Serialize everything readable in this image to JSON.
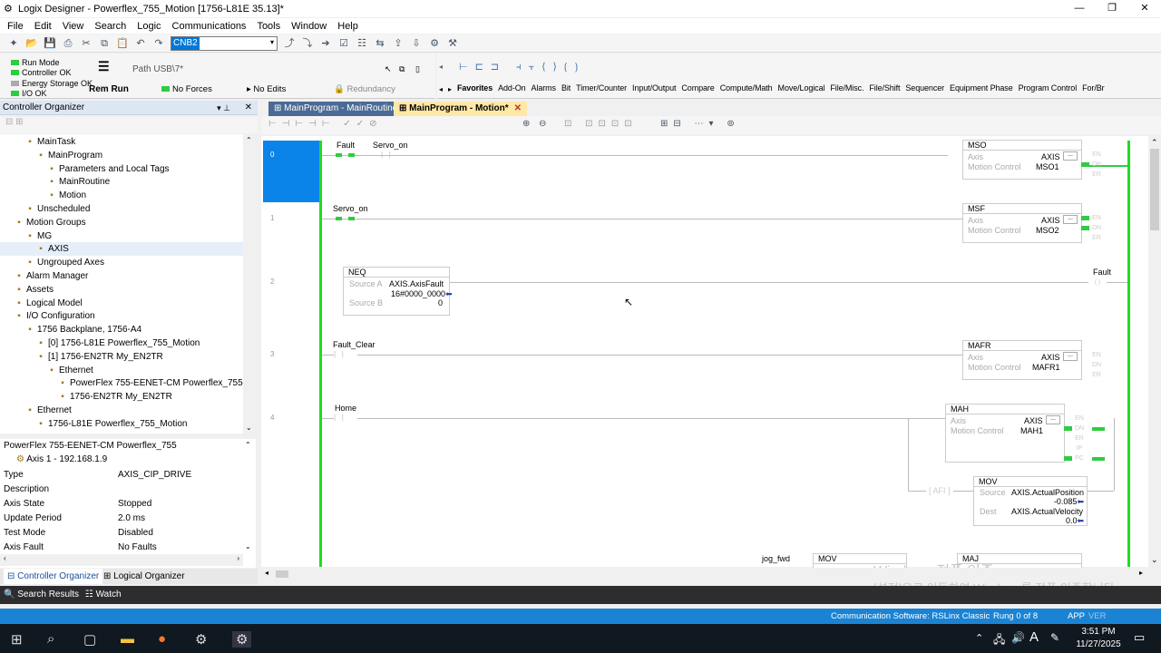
{
  "window": {
    "title": "Logix Designer - Powerflex_755_Motion [1756-L81E 35.13]*",
    "controls": [
      "—",
      "❐",
      "✕"
    ]
  },
  "menu": [
    "File",
    "Edit",
    "View",
    "Search",
    "Logic",
    "Communications",
    "Tools",
    "Window",
    "Help"
  ],
  "toolbar": {
    "combo_value": "CNB2"
  },
  "status": {
    "run_mode": "Run Mode",
    "controller_ok": "Controller OK",
    "energy_storage_ok": "Energy Storage OK",
    "io_ok": "I/O OK",
    "rem_run": "Rem Run",
    "path": "Path USB\\7*",
    "forces": "No Forces",
    "edits": "No Edits",
    "redundancy": "Redundancy"
  },
  "instruction_tabs": [
    "Favorites",
    "Add-On",
    "Alarms",
    "Bit",
    "Timer/Counter",
    "Input/Output",
    "Compare",
    "Compute/Math",
    "Move/Logical",
    "File/Misc.",
    "File/Shift",
    "Sequencer",
    "Equipment Phase",
    "Program Control",
    "For/Br"
  ],
  "organizer": {
    "title": "Controller Organizer",
    "tree": [
      {
        "label": "MainTask",
        "depth": 2
      },
      {
        "label": "MainProgram",
        "depth": 3
      },
      {
        "label": "Parameters and Local Tags",
        "depth": 4
      },
      {
        "label": "MainRoutine",
        "depth": 4
      },
      {
        "label": "Motion",
        "depth": 4
      },
      {
        "label": "Unscheduled",
        "depth": 2
      },
      {
        "label": "Motion Groups",
        "depth": 1
      },
      {
        "label": "MG",
        "depth": 2
      },
      {
        "label": "AXIS",
        "depth": 3
      },
      {
        "label": "Ungrouped Axes",
        "depth": 2
      },
      {
        "label": "Alarm Manager",
        "depth": 1
      },
      {
        "label": "Assets",
        "depth": 1
      },
      {
        "label": "Logical Model",
        "depth": 1
      },
      {
        "label": "I/O Configuration",
        "depth": 1
      },
      {
        "label": "1756 Backplane, 1756-A4",
        "depth": 2
      },
      {
        "label": "[0] 1756-L81E Powerflex_755_Motion",
        "depth": 3
      },
      {
        "label": "[1] 1756-EN2TR My_EN2TR",
        "depth": 3
      },
      {
        "label": "Ethernet",
        "depth": 4
      },
      {
        "label": "PowerFlex 755-EENET-CM Powerflex_755",
        "depth": 5
      },
      {
        "label": "1756-EN2TR My_EN2TR",
        "depth": 5
      },
      {
        "label": "Ethernet",
        "depth": 2
      },
      {
        "label": "1756-L81E Powerflex_755_Motion",
        "depth": 3
      }
    ],
    "props_header": "PowerFlex 755-EENET-CM  Powerflex_755",
    "props_sub": "Axis 1 - 192.168.1.9",
    "props": [
      {
        "k": "Type",
        "v": "AXIS_CIP_DRIVE"
      },
      {
        "k": "Description",
        "v": ""
      },
      {
        "k": "Axis State",
        "v": "Stopped"
      },
      {
        "k": "Update Period",
        "v": "2.0 ms"
      },
      {
        "k": "Test Mode",
        "v": "Disabled"
      },
      {
        "k": "Axis Fault",
        "v": "No Faults"
      }
    ],
    "bottom_tabs": [
      "Controller Organizer",
      "Logical Organizer"
    ]
  },
  "editor": {
    "tabs": [
      "MainProgram - MainRoutine",
      "MainProgram - Motion*"
    ],
    "rung_numbers": [
      "0",
      "1",
      "2",
      "3",
      "4"
    ],
    "rung0": {
      "c1": "Fault",
      "c2": "Servo_on",
      "box": {
        "title": "MSO",
        "axis_k": "Axis",
        "axis_v": "AXIS",
        "mc_k": "Motion Control",
        "mc_v": "MSO1"
      }
    },
    "rung1": {
      "c1": "Servo_on",
      "box": {
        "title": "MSF",
        "axis_k": "Axis",
        "axis_v": "AXIS",
        "mc_k": "Motion Control",
        "mc_v": "MSO2"
      }
    },
    "rung2": {
      "box": {
        "title": "NEQ",
        "a_k": "Source A",
        "a_v": "AXIS.AxisFault",
        "a_val": "16#0000_0000",
        "b_k": "Source B",
        "b_v": "0"
      },
      "coil": "Fault"
    },
    "rung3": {
      "c1": "Fault_Clear",
      "box": {
        "title": "MAFR",
        "axis_k": "Axis",
        "axis_v": "AXIS",
        "mc_k": "Motion Control",
        "mc_v": "MAFR1"
      }
    },
    "rung4": {
      "c1": "Home",
      "box": {
        "title": "MAH",
        "axis_k": "Axis",
        "axis_v": "AXIS",
        "mc_k": "Motion Control",
        "mc_v": "MAH1"
      },
      "afi": "AFI",
      "mov": {
        "title": "MOV",
        "s_k": "Source",
        "s_v": "AXIS.ActualPosition",
        "s_val": "-0.085",
        "d_k": "Dest",
        "d_v": "AXIS.ActualVelocity",
        "d_val": "0.0"
      }
    },
    "rung5": {
      "c1": "jog_fwd",
      "b1": "MOV",
      "b2": "MAJ"
    },
    "coils": {
      "en": "EN",
      "dn": "DN",
      "er": "ER",
      "ip": "IP",
      "pc": "PC"
    },
    "ellipsis": "..."
  },
  "bottom": {
    "search_results": "Search Results",
    "watch": "Watch"
  },
  "statusbar": {
    "comm": "Communication Software: RSLinx Classic",
    "rung": "Rung 0 of 8",
    "app": "APP",
    "ver": "VER"
  },
  "watermark": {
    "line1": "Windows 정품 인증",
    "line2": "[설정]으로 이동하여 Windows를 정품 인증합니다."
  },
  "taskbar": {
    "time": "3:51 PM",
    "date": "11/27/2025",
    "lang": "A"
  }
}
